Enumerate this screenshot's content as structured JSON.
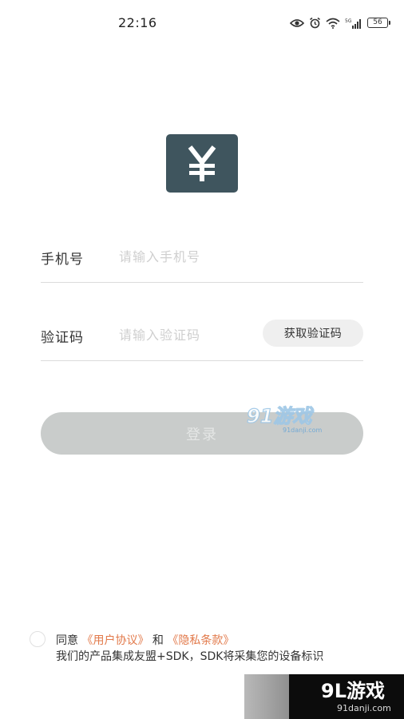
{
  "status_bar": {
    "time": "22:16",
    "battery": "56",
    "icons": [
      "eye-icon",
      "alarm-icon",
      "wifi-icon",
      "signal-5g-icon",
      "battery-icon"
    ]
  },
  "logo": {
    "icon": "yen-icon",
    "symbol": "¥",
    "bg_color": "#3f555e"
  },
  "form": {
    "phone": {
      "label": "手机号",
      "placeholder": "请输入手机号"
    },
    "code": {
      "label": "验证码",
      "placeholder": "请输入验证码",
      "get_code_label": "获取验证码"
    },
    "login_label": "登录"
  },
  "agreement": {
    "prefix": "同意",
    "user_agreement": "《用户协议》",
    "and": "和",
    "privacy_policy": "《隐私条款》",
    "notice": "我们的产品集成友盟+SDK，SDK将采集您的设备标识",
    "link_color": "#e2794a"
  },
  "watermarks": {
    "mid_brand": "91游戏",
    "mid_domain": "91danji.com",
    "corner_brand": "9L游戏",
    "corner_domain": "91danji.com"
  }
}
